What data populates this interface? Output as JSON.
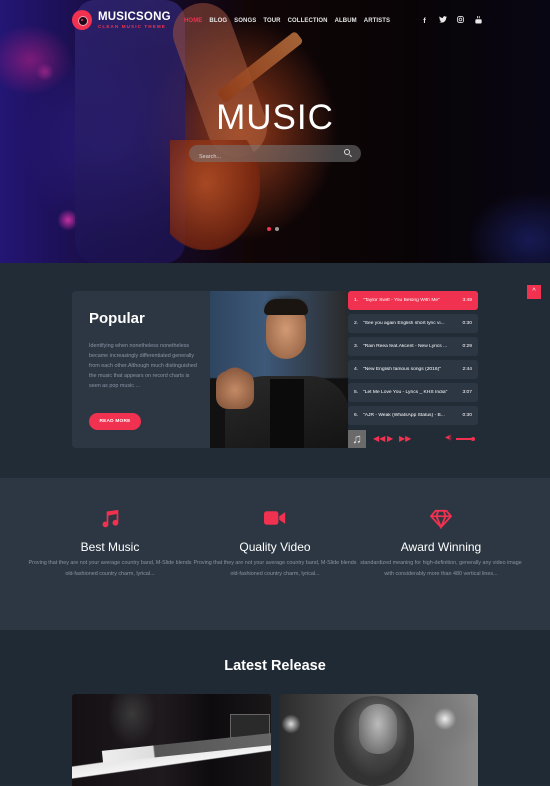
{
  "brand": {
    "name": "MUSICSONG",
    "tagline": "CLEAN MUSIC THEME",
    "accent": "#f0314f"
  },
  "nav": {
    "items": [
      {
        "label": "HOME",
        "active": true
      },
      {
        "label": "BLOG",
        "active": false
      },
      {
        "label": "SONGS",
        "active": false
      },
      {
        "label": "TOUR",
        "active": false
      },
      {
        "label": "COLLECTION",
        "active": false
      },
      {
        "label": "ALBUM",
        "active": false
      },
      {
        "label": "ARTISTS",
        "active": false
      }
    ],
    "social": [
      {
        "icon": "facebook-icon",
        "glyph": "f"
      },
      {
        "icon": "twitter-icon",
        "glyph": "t"
      },
      {
        "icon": "instagram-icon",
        "glyph": "◎"
      },
      {
        "icon": "youtube-icon",
        "glyph": "▣"
      }
    ]
  },
  "hero": {
    "title": "MUSIC",
    "search_placeholder": "Search...",
    "search_value": "",
    "slides": 2,
    "active_slide": 1
  },
  "popular": {
    "title": "Popular",
    "description": "Identifying when nonetheless nonetheless became increasingly differentiated generally from each other.Although much distinguished the music that appears on record charts is seen as pop music....",
    "read_more": "READ MORE",
    "tracks": [
      {
        "num": "1.",
        "name": "\"Taylor Swift - You Belong With Me\"",
        "duration": "3:49",
        "active": true
      },
      {
        "num": "2.",
        "name": "\"See you again English short lyric vi...",
        "duration": "0:30",
        "active": false
      },
      {
        "num": "3.",
        "name": "\"Rain Reea feat.Akcent - New Lyrics ...",
        "duration": "0:29",
        "active": false
      },
      {
        "num": "4.",
        "name": "\"New English famous songs (2016)\"",
        "duration": "2:44",
        "active": false
      },
      {
        "num": "5.",
        "name": "\"Let Me Love You - Lyrics _ KHS India\"",
        "duration": "3:07",
        "active": false
      },
      {
        "num": "6.",
        "name": "\"AJR - Weak (WhatsApp Status) - B...",
        "duration": "0:30",
        "active": false
      }
    ],
    "player": {
      "note_glyph": "♫",
      "prev": "◀◀",
      "play": "▶",
      "next": "▶▶",
      "volume_glyph": "◀)",
      "volume": 0.9
    }
  },
  "scroll_top": "^",
  "features": [
    {
      "icon": "music-note-icon",
      "title": "Best Music",
      "desc": "Proving that they are not your average country band, M-Slide blends old-fashioned country charm, lyrical..."
    },
    {
      "icon": "video-camera-icon",
      "title": "Quality Video",
      "desc": "Proving that they are not your average country band, M-Slide blends old-fashioned country charm, lyrical..."
    },
    {
      "icon": "diamond-icon",
      "title": "Award Winning",
      "desc": "standardized meaning for high-definition, generally any video image with considerably more than 480 vertical lines..."
    }
  ],
  "latest": {
    "title": "Latest Release"
  }
}
